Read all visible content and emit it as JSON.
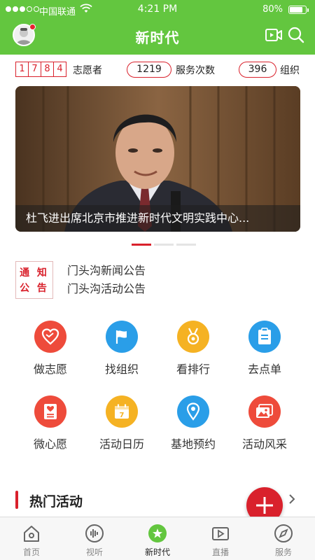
{
  "status_bar": {
    "carrier": "中国联通",
    "time": "4:21 PM",
    "battery": "80%",
    "battery_level": 0.8
  },
  "header": {
    "title": "新时代",
    "avatar_icon": "avatar-icon",
    "video_icon": "video-camera-icon",
    "search_icon": "search-icon"
  },
  "stats": {
    "volunteer_digits": [
      "1",
      "7",
      "8",
      "4"
    ],
    "volunteer_label": "志愿者",
    "service_count": "1219",
    "service_label": "服务次数",
    "org_count": "396",
    "org_label": "组织"
  },
  "banner": {
    "caption": "杜飞进出席北京市推进新时代文明实践中心...",
    "active_slide": 1,
    "slide_count": 3
  },
  "notice": {
    "badge_line1": "通 知",
    "badge_line2": "公 告",
    "items": [
      "门头沟新闻公告",
      "门头沟活动公告"
    ]
  },
  "grid": [
    {
      "label": "做志愿",
      "icon": "heart-icon",
      "color": "#ee4b3b"
    },
    {
      "label": "找组织",
      "icon": "flag-icon",
      "color": "#2a9ee8"
    },
    {
      "label": "看排行",
      "icon": "medal-icon",
      "color": "#f5b223"
    },
    {
      "label": "去点单",
      "icon": "clipboard-icon",
      "color": "#2a9ee8"
    },
    {
      "label": "微心愿",
      "icon": "wish-card-icon",
      "color": "#ee4b3b"
    },
    {
      "label": "活动日历",
      "icon": "calendar-icon",
      "color": "#f5b223"
    },
    {
      "label": "基地预约",
      "icon": "location-pin-icon",
      "color": "#2a9ee8"
    },
    {
      "label": "活动风采",
      "icon": "photo-gallery-icon",
      "color": "#ee4b3b"
    }
  ],
  "calendar_day": "7",
  "hot": {
    "title": "热门活动"
  },
  "tabbar": {
    "items": [
      {
        "label": "首页",
        "icon": "home-icon"
      },
      {
        "label": "视听",
        "icon": "audio-wave-icon"
      },
      {
        "label": "新时代",
        "icon": "star-icon",
        "active": true
      },
      {
        "label": "直播",
        "icon": "live-video-icon"
      },
      {
        "label": "服务",
        "icon": "compass-icon"
      }
    ]
  },
  "colors": {
    "brand_green": "#63c63f",
    "accent_red": "#d9212c"
  }
}
